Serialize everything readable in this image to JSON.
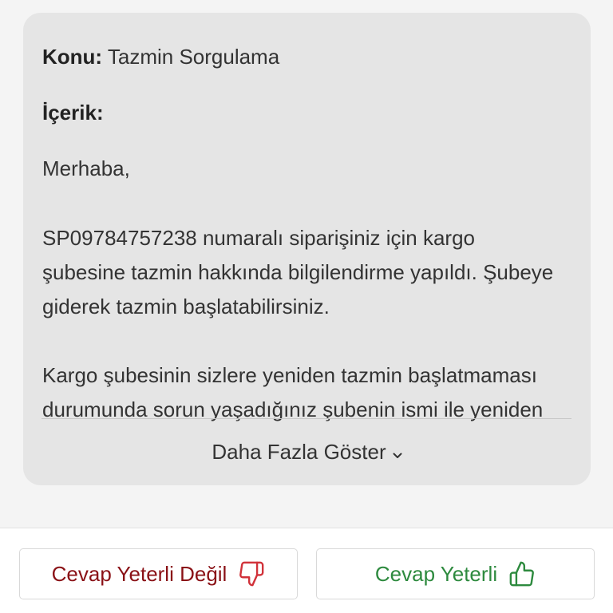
{
  "message": {
    "subject_label": "Konu:",
    "subject_value": "Tazmin Sorgulama",
    "content_label": "İçerik:",
    "greeting": "Merhaba,",
    "paragraph1_lines": [
      "SP09784757238 numaralı siparişiniz için kargo",
      "şubesine tazmin hakkında bilgilendirme yapıldı. Şubeye",
      "giderek tazmin başlatabilirsiniz."
    ],
    "paragraph2_lines": [
      "Kargo şubesinin sizlere yeniden tazmin başlatmaması",
      "durumunda sorun yaşadığınız şubenin ismi ile yeniden"
    ],
    "show_more_label": "Daha Fazla Göster"
  },
  "feedback": {
    "not_sufficient_label": "Cevap Yeterli Değil",
    "sufficient_label": "Cevap Yeterli",
    "not_sufficient_icon": "thumbs-down-icon",
    "sufficient_icon": "thumbs-up-icon",
    "negative_color": "#8a1116",
    "positive_color": "#2d8a3e"
  }
}
